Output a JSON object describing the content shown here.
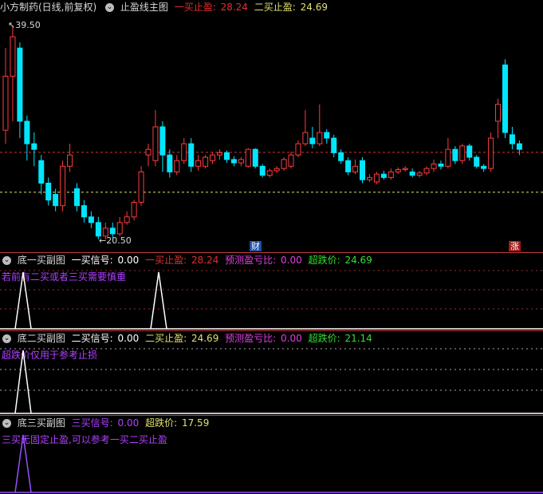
{
  "main": {
    "stock_title": "小方制药(日线,前复权)",
    "indicator_name": "止盈线主图",
    "line1_label": "一买止盈:",
    "line1_value": "28.24",
    "line2_label": "二买止盈:",
    "line2_value": "24.69",
    "high_label": "39.50",
    "low_label": "20.50",
    "badge_cai": "财",
    "badge_zhang": "涨",
    "colors": {
      "up": "#ff3c3c",
      "down": "#00e6ff",
      "line1": "#e03030",
      "line2": "#e0e070"
    }
  },
  "sub1": {
    "name": "底一买副图",
    "signal_label": "一买信号:",
    "signal_value": "0.00",
    "stop_label": "一买止盈:",
    "stop_value": "28.24",
    "ratio_label": "预测盈亏比:",
    "ratio_value": "0.00",
    "oversold_label": "超跌价:",
    "oversold_value": "24.69",
    "note": "若前有二买或者三买需要慎重"
  },
  "sub2": {
    "name": "底二买副图",
    "signal_label": "二买信号:",
    "signal_value": "0.00",
    "stop_label": "二买止盈:",
    "stop_value": "24.69",
    "ratio_label": "预测盈亏比:",
    "ratio_value": "0.00",
    "oversold_label": "超跌价:",
    "oversold_value": "21.14",
    "note": "超跌价仅用于参考止损"
  },
  "sub3": {
    "name": "底三买副图",
    "signal_label": "三买信号:",
    "signal_value": "0.00",
    "oversold_label": "超跌价:",
    "oversold_value": "17.59",
    "note": "三买无固定止盈,可以参考一买二买止盈"
  },
  "chart_data": {
    "type": "candlestick",
    "price_high": 39.5,
    "price_low": 20.5,
    "levels": [
      28.24,
      24.69
    ],
    "candles": [
      {
        "o": 30.2,
        "c": 35.0,
        "h": 37.5,
        "l": 29.0
      },
      {
        "o": 35.0,
        "c": 38.5,
        "h": 39.5,
        "l": 31.0
      },
      {
        "o": 37.5,
        "c": 31.0,
        "h": 38.0,
        "l": 29.5
      },
      {
        "o": 31.0,
        "c": 29.0,
        "h": 31.5,
        "l": 27.5
      },
      {
        "o": 29.0,
        "c": 28.5,
        "h": 30.0,
        "l": 27.0
      },
      {
        "o": 27.5,
        "c": 25.5,
        "h": 28.0,
        "l": 24.5
      },
      {
        "o": 25.5,
        "c": 24.0,
        "h": 26.0,
        "l": 23.5
      },
      {
        "o": 24.5,
        "c": 23.5,
        "h": 25.0,
        "l": 23.0
      },
      {
        "o": 23.5,
        "c": 27.0,
        "h": 27.5,
        "l": 23.0
      },
      {
        "o": 27.0,
        "c": 28.0,
        "h": 29.0,
        "l": 26.5
      },
      {
        "o": 25.0,
        "c": 23.5,
        "h": 25.5,
        "l": 23.0
      },
      {
        "o": 23.5,
        "c": 22.5,
        "h": 24.0,
        "l": 22.0
      },
      {
        "o": 22.5,
        "c": 22.0,
        "h": 23.0,
        "l": 21.5
      },
      {
        "o": 22.0,
        "c": 20.8,
        "h": 22.5,
        "l": 20.5
      },
      {
        "o": 20.8,
        "c": 21.5,
        "h": 22.0,
        "l": 20.5
      },
      {
        "o": 21.5,
        "c": 21.0,
        "h": 22.0,
        "l": 20.6
      },
      {
        "o": 21.0,
        "c": 22.0,
        "h": 22.5,
        "l": 20.8
      },
      {
        "o": 22.0,
        "c": 22.5,
        "h": 23.0,
        "l": 21.8
      },
      {
        "o": 22.5,
        "c": 23.8,
        "h": 24.0,
        "l": 22.2
      },
      {
        "o": 23.8,
        "c": 26.5,
        "h": 27.0,
        "l": 23.5
      },
      {
        "o": 28.0,
        "c": 28.5,
        "h": 29.0,
        "l": 27.0
      },
      {
        "o": 27.5,
        "c": 30.5,
        "h": 32.0,
        "l": 27.0
      },
      {
        "o": 30.5,
        "c": 28.0,
        "h": 31.0,
        "l": 26.5
      },
      {
        "o": 28.0,
        "c": 26.5,
        "h": 28.5,
        "l": 26.0
      },
      {
        "o": 26.5,
        "c": 27.5,
        "h": 28.0,
        "l": 26.2
      },
      {
        "o": 27.5,
        "c": 29.0,
        "h": 29.5,
        "l": 27.2
      },
      {
        "o": 29.0,
        "c": 27.0,
        "h": 29.5,
        "l": 26.5
      },
      {
        "o": 27.0,
        "c": 27.5,
        "h": 28.0,
        "l": 26.6
      },
      {
        "o": 27.0,
        "c": 27.8,
        "h": 28.0,
        "l": 26.8
      },
      {
        "o": 27.5,
        "c": 28.0,
        "h": 28.2,
        "l": 27.2
      },
      {
        "o": 28.0,
        "c": 28.2,
        "h": 28.5,
        "l": 27.6
      },
      {
        "o": 28.2,
        "c": 27.6,
        "h": 28.4,
        "l": 27.3
      },
      {
        "o": 27.6,
        "c": 27.3,
        "h": 27.9,
        "l": 27.0
      },
      {
        "o": 27.3,
        "c": 27.6,
        "h": 27.8,
        "l": 27.0
      },
      {
        "o": 27.0,
        "c": 28.5,
        "h": 28.6,
        "l": 26.9
      },
      {
        "o": 28.5,
        "c": 27.0,
        "h": 28.6,
        "l": 26.8
      },
      {
        "o": 27.0,
        "c": 26.2,
        "h": 27.2,
        "l": 26.0
      },
      {
        "o": 26.2,
        "c": 26.6,
        "h": 26.8,
        "l": 26.0
      },
      {
        "o": 26.6,
        "c": 26.8,
        "h": 27.0,
        "l": 26.4
      },
      {
        "o": 26.8,
        "c": 27.6,
        "h": 27.8,
        "l": 26.6
      },
      {
        "o": 27.0,
        "c": 28.0,
        "h": 28.3,
        "l": 26.8
      },
      {
        "o": 28.0,
        "c": 29.0,
        "h": 29.3,
        "l": 27.8
      },
      {
        "o": 29.0,
        "c": 30.0,
        "h": 32.0,
        "l": 28.8
      },
      {
        "o": 29.5,
        "c": 29.0,
        "h": 30.5,
        "l": 28.6
      },
      {
        "o": 29.0,
        "c": 30.0,
        "h": 32.5,
        "l": 28.8
      },
      {
        "o": 30.0,
        "c": 29.5,
        "h": 30.3,
        "l": 29.0
      },
      {
        "o": 29.5,
        "c": 28.2,
        "h": 29.8,
        "l": 27.8
      },
      {
        "o": 28.2,
        "c": 27.5,
        "h": 28.5,
        "l": 27.2
      },
      {
        "o": 27.5,
        "c": 26.5,
        "h": 27.8,
        "l": 26.2
      },
      {
        "o": 26.5,
        "c": 27.0,
        "h": 27.6,
        "l": 26.3
      },
      {
        "o": 27.5,
        "c": 25.8,
        "h": 27.8,
        "l": 25.5
      },
      {
        "o": 25.8,
        "c": 26.0,
        "h": 26.3,
        "l": 25.6
      },
      {
        "o": 25.6,
        "c": 26.3,
        "h": 26.5,
        "l": 25.4
      },
      {
        "o": 26.3,
        "c": 26.0,
        "h": 26.6,
        "l": 25.8
      },
      {
        "o": 26.0,
        "c": 26.5,
        "h": 26.8,
        "l": 25.8
      },
      {
        "o": 26.5,
        "c": 26.7,
        "h": 26.9,
        "l": 26.3
      },
      {
        "o": 26.7,
        "c": 26.8,
        "h": 27.0,
        "l": 26.5
      },
      {
        "o": 26.5,
        "c": 26.2,
        "h": 26.8,
        "l": 26.0
      },
      {
        "o": 26.2,
        "c": 26.4,
        "h": 26.6,
        "l": 26.0
      },
      {
        "o": 26.4,
        "c": 26.8,
        "h": 27.0,
        "l": 26.2
      },
      {
        "o": 26.8,
        "c": 27.2,
        "h": 27.6,
        "l": 26.5
      },
      {
        "o": 27.2,
        "c": 27.0,
        "h": 27.5,
        "l": 26.7
      },
      {
        "o": 27.0,
        "c": 28.5,
        "h": 29.5,
        "l": 26.8
      },
      {
        "o": 28.5,
        "c": 27.5,
        "h": 28.8,
        "l": 27.2
      },
      {
        "o": 27.5,
        "c": 28.8,
        "h": 29.0,
        "l": 27.2
      },
      {
        "o": 28.8,
        "c": 27.8,
        "h": 29.0,
        "l": 27.5
      },
      {
        "o": 27.8,
        "c": 27.0,
        "h": 28.0,
        "l": 26.8
      },
      {
        "o": 27.0,
        "c": 26.8,
        "h": 27.2,
        "l": 26.5
      },
      {
        "o": 26.8,
        "c": 29.5,
        "h": 30.0,
        "l": 26.5
      },
      {
        "o": 31.0,
        "c": 32.5,
        "h": 33.0,
        "l": 29.5
      },
      {
        "o": 36.0,
        "c": 30.0,
        "h": 36.5,
        "l": 29.5
      },
      {
        "o": 29.8,
        "c": 29.0,
        "h": 30.5,
        "l": 28.5
      },
      {
        "o": 29.0,
        "c": 28.5,
        "h": 29.3,
        "l": 28.0
      }
    ],
    "subcharts": [
      {
        "name": "底一买副图",
        "spikes": [
          {
            "idx": 4,
            "h": 1
          },
          {
            "idx": 28,
            "h": 1
          }
        ],
        "color": "#ffffff"
      },
      {
        "name": "底二买副图",
        "spikes": [
          {
            "idx": 4,
            "h": 1
          }
        ],
        "color": "#ffffff"
      },
      {
        "name": "底三买副图",
        "spikes": [
          {
            "idx": 4,
            "h": 1
          }
        ],
        "color": "#9a4dff"
      }
    ]
  }
}
